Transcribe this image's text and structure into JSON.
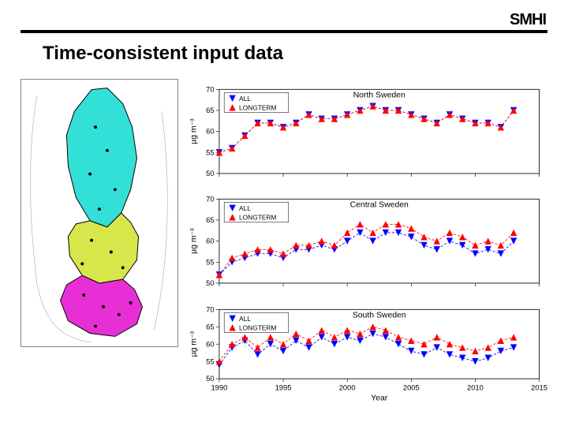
{
  "logo": "SMHI",
  "title": "Time-consistent input data",
  "xlabel": "Year",
  "ylabel": "µg m⁻³",
  "legend": {
    "a": "ALL",
    "b": "LONGTERM"
  },
  "yticks": [
    50,
    55,
    60,
    65,
    70
  ],
  "xticks": [
    1990,
    1995,
    2000,
    2005,
    2010,
    2015
  ],
  "chart_data": [
    {
      "type": "line",
      "title": "North Sweden",
      "x": [
        1990,
        1991,
        1992,
        1993,
        1994,
        1995,
        1996,
        1997,
        1998,
        1999,
        2000,
        2001,
        2002,
        2003,
        2004,
        2005,
        2006,
        2007,
        2008,
        2009,
        2010,
        2011,
        2012,
        2013
      ],
      "series": [
        {
          "name": "ALL",
          "marker": "down",
          "color": "#0000ff",
          "values": [
            55,
            56,
            59,
            62,
            62,
            61,
            62,
            64,
            63,
            63,
            64,
            65,
            66,
            65,
            65,
            64,
            63,
            62,
            64,
            63,
            62,
            62,
            61,
            65
          ]
        },
        {
          "name": "LONGTERM",
          "marker": "up",
          "color": "#ff0000",
          "values": [
            55,
            56,
            59,
            62,
            62,
            61,
            62,
            64,
            63,
            63,
            64,
            65,
            66,
            65,
            65,
            64,
            63,
            62,
            64,
            63,
            62,
            62,
            61,
            65
          ]
        }
      ],
      "ylim": [
        50,
        70
      ],
      "xlim": [
        1990,
        2015
      ]
    },
    {
      "type": "line",
      "title": "Central Sweden",
      "x": [
        1990,
        1991,
        1992,
        1993,
        1994,
        1995,
        1996,
        1997,
        1998,
        1999,
        2000,
        2001,
        2002,
        2003,
        2004,
        2005,
        2006,
        2007,
        2008,
        2009,
        2010,
        2011,
        2012,
        2013
      ],
      "series": [
        {
          "name": "ALL",
          "marker": "down",
          "color": "#0000ff",
          "values": [
            52,
            55,
            56,
            57,
            57,
            56,
            58,
            58,
            59,
            58,
            60,
            62,
            60,
            62,
            62,
            61,
            59,
            58,
            60,
            59,
            57,
            58,
            57,
            60
          ]
        },
        {
          "name": "LONGTERM",
          "marker": "up",
          "color": "#ff0000",
          "values": [
            52,
            56,
            57,
            58,
            58,
            57,
            59,
            59,
            60,
            59,
            62,
            64,
            62,
            64,
            64,
            63,
            61,
            60,
            62,
            61,
            59,
            60,
            59,
            62
          ]
        }
      ],
      "ylim": [
        50,
        70
      ],
      "xlim": [
        1990,
        2015
      ]
    },
    {
      "type": "line",
      "title": "South Sweden",
      "x": [
        1990,
        1991,
        1992,
        1993,
        1994,
        1995,
        1996,
        1997,
        1998,
        1999,
        2000,
        2001,
        2002,
        2003,
        2004,
        2005,
        2006,
        2007,
        2008,
        2009,
        2010,
        2011,
        2012,
        2013
      ],
      "series": [
        {
          "name": "ALL",
          "marker": "down",
          "color": "#0000ff",
          "values": [
            54,
            59,
            61,
            57,
            60,
            58,
            61,
            59,
            62,
            60,
            62,
            61,
            63,
            62,
            60,
            58,
            57,
            59,
            57,
            56,
            55,
            56,
            58,
            59
          ]
        },
        {
          "name": "LONGTERM",
          "marker": "up",
          "color": "#ff0000",
          "values": [
            55,
            60,
            62,
            59,
            62,
            60,
            63,
            61,
            64,
            62,
            64,
            63,
            65,
            64,
            62,
            61,
            60,
            62,
            60,
            59,
            58,
            59,
            61,
            62
          ]
        }
      ],
      "ylim": [
        50,
        70
      ],
      "xlim": [
        1990,
        2015
      ]
    }
  ]
}
